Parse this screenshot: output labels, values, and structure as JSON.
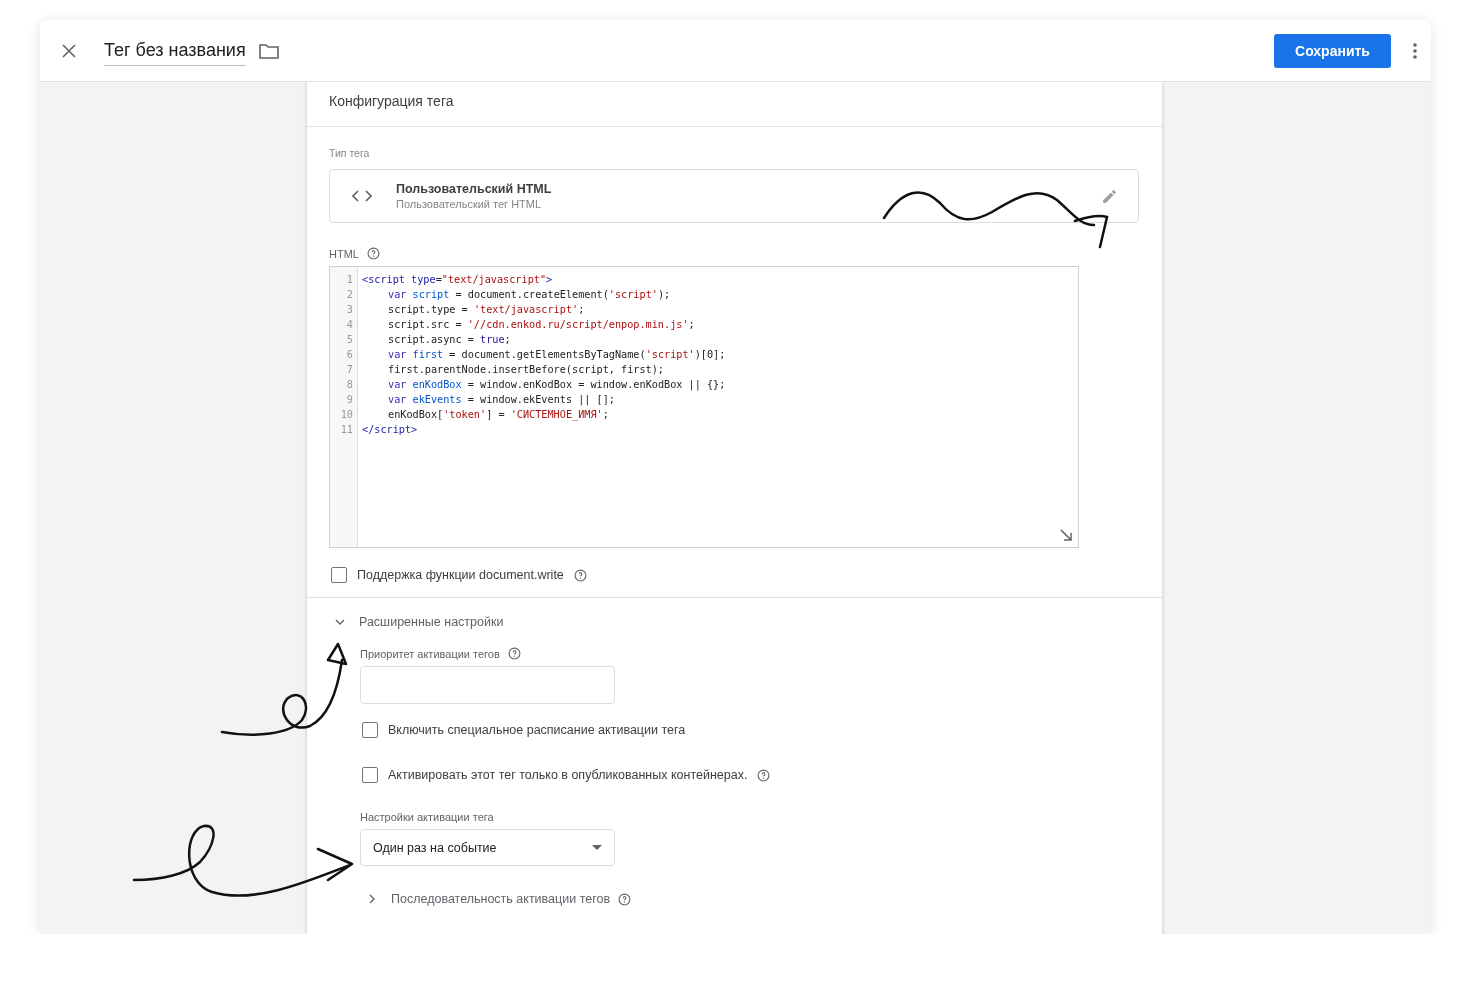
{
  "header": {
    "title": "Тег без названия",
    "save_button": "Сохранить"
  },
  "card": {
    "title": "Конфигурация тега",
    "tag_type_label": "Тип тега",
    "tag_type": {
      "name": "Пользовательский HTML",
      "description": "Пользовательский тег HTML"
    },
    "html_label": "HTML",
    "code_lines": [
      {
        "number": "1",
        "indent": false,
        "tokens": [
          {
            "kind": "tag",
            "text": "<script "
          },
          {
            "kind": "attr",
            "text": "type"
          },
          {
            "kind": "plain",
            "text": "="
          },
          {
            "kind": "string",
            "text": "\"text/javascript\""
          },
          {
            "kind": "tag",
            "text": ">"
          }
        ]
      },
      {
        "number": "2",
        "indent": true,
        "tokens": [
          {
            "kind": "keyword",
            "text": "var "
          },
          {
            "kind": "def",
            "text": "script"
          },
          {
            "kind": "plain",
            "text": " = document.createElement("
          },
          {
            "kind": "string",
            "text": "'script'"
          },
          {
            "kind": "plain",
            "text": ");"
          }
        ]
      },
      {
        "number": "3",
        "indent": true,
        "tokens": [
          {
            "kind": "plain",
            "text": "script.type = "
          },
          {
            "kind": "string",
            "text": "'text/javascript'"
          },
          {
            "kind": "plain",
            "text": ";"
          }
        ]
      },
      {
        "number": "4",
        "indent": true,
        "tokens": [
          {
            "kind": "plain",
            "text": "script.src = "
          },
          {
            "kind": "string",
            "text": "'//cdn.enkod.ru/script/enpop.min.js'"
          },
          {
            "kind": "plain",
            "text": ";"
          }
        ]
      },
      {
        "number": "5",
        "indent": true,
        "tokens": [
          {
            "kind": "plain",
            "text": "script.async = "
          },
          {
            "kind": "atom",
            "text": "true"
          },
          {
            "kind": "plain",
            "text": ";"
          }
        ]
      },
      {
        "number": "6",
        "indent": true,
        "tokens": [
          {
            "kind": "keyword",
            "text": "var "
          },
          {
            "kind": "def",
            "text": "first"
          },
          {
            "kind": "plain",
            "text": " = document.getElementsByTagName("
          },
          {
            "kind": "string",
            "text": "'script'"
          },
          {
            "kind": "plain",
            "text": ")[0];"
          }
        ]
      },
      {
        "number": "7",
        "indent": true,
        "tokens": [
          {
            "kind": "plain",
            "text": "first.parentNode.insertBefore(script, first);"
          }
        ]
      },
      {
        "number": "8",
        "indent": true,
        "tokens": [
          {
            "kind": "keyword",
            "text": "var "
          },
          {
            "kind": "def",
            "text": "enKodBox"
          },
          {
            "kind": "plain",
            "text": " = window.enKodBox = window.enKodBox || {};"
          }
        ]
      },
      {
        "number": "9",
        "indent": true,
        "tokens": [
          {
            "kind": "keyword",
            "text": "var "
          },
          {
            "kind": "def",
            "text": "ekEvents"
          },
          {
            "kind": "plain",
            "text": " = window.ekEvents || [];"
          }
        ]
      },
      {
        "number": "10",
        "indent": true,
        "tokens": [
          {
            "kind": "plain",
            "text": "enKodBox["
          },
          {
            "kind": "string",
            "text": "'token'"
          },
          {
            "kind": "plain",
            "text": "] = "
          },
          {
            "kind": "string",
            "text": "'СИСТЕМНОЕ_ИМЯ'"
          },
          {
            "kind": "plain",
            "text": ";"
          }
        ]
      },
      {
        "number": "11",
        "indent": false,
        "tokens": [
          {
            "kind": "tag",
            "text": "</script>"
          }
        ]
      }
    ],
    "document_write": {
      "label": "Поддержка функции document.write",
      "checked": false
    },
    "advanced": {
      "title": "Расширенные настройки",
      "expanded": true,
      "priority_label": "Приоритет активации тегов",
      "schedule": {
        "label": "Включить специальное расписание активации тега",
        "checked": false
      },
      "published_only": {
        "label": "Активировать этот тег только в опубликованных контейнерах.",
        "checked": false
      },
      "activation_label": "Настройки активации тега",
      "activation_select": "Один раз на событие"
    },
    "sequence": {
      "label": "Последовательность активации тегов",
      "expanded": false
    }
  }
}
